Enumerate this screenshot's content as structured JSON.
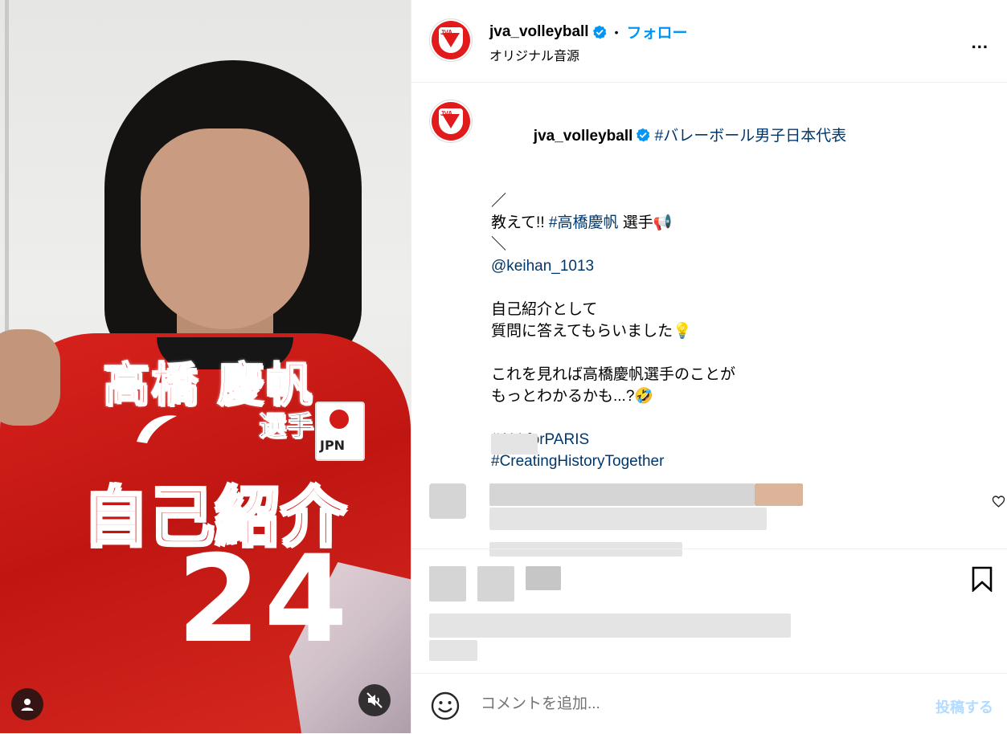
{
  "media": {
    "overlay_name": "高橋 慶帆",
    "overlay_senshu": "選手",
    "overlay_title": "自己紹介",
    "jersey_number": "24",
    "jersey_country": "JPN",
    "user_icon": "user-icon",
    "mute_icon": "speaker-muted-icon"
  },
  "header": {
    "username": "jva_volleyball",
    "dot": "•",
    "follow_label": "フォロー",
    "audio_label": "オリジナル音源",
    "more_label": "..."
  },
  "caption": {
    "username": "jva_volleyball",
    "hashtag_main": "#バレーボール男子日本代表",
    "line_slash": "／",
    "line_teach_prefix": "教えて!! ",
    "line_teach_tag": "#高橋慶帆",
    "line_teach_suffix": " 選手📢",
    "line_backslash": "＼",
    "mention": "@keihan_1013",
    "line_intro1": "自己紹介として",
    "line_intro2": "質問に答えてもらいました💡",
    "line_more1": "これを見れば高橋慶帆選手のことが",
    "line_more2": "もっとわかるかも...?🤣",
    "tag1": "#ALLforPARIS",
    "tag2": "#CreatingHistoryTogether"
  },
  "actions": {
    "heart_icon": "heart-icon",
    "bookmark_icon": "bookmark-icon"
  },
  "comment": {
    "placeholder": "コメントを追加...",
    "post_label": "投稿する"
  },
  "colors": {
    "accent": "#0095f6",
    "link": "#00376b",
    "brand_red": "#e11b1b",
    "post_disabled": "#b3dbff"
  }
}
